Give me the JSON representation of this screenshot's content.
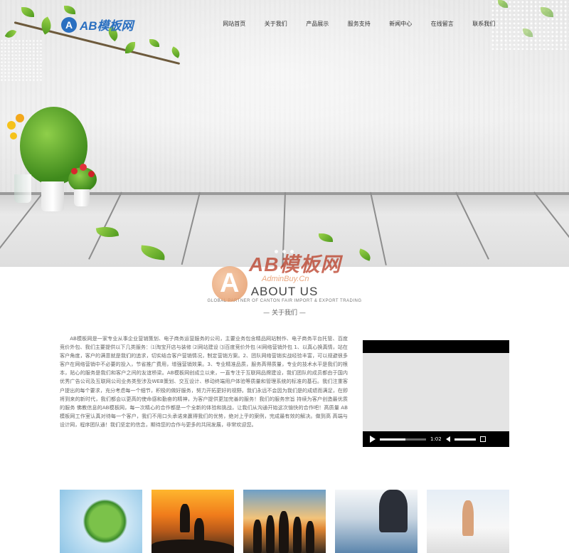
{
  "header": {
    "logo_mark": "A",
    "logo_text": "AB模板网"
  },
  "nav": {
    "items": [
      {
        "label": "网站首页"
      },
      {
        "label": "关于我们"
      },
      {
        "label": "产品展示"
      },
      {
        "label": "服务支持"
      },
      {
        "label": "新闻中心"
      },
      {
        "label": "在线留言"
      },
      {
        "label": "联系我们"
      }
    ]
  },
  "watermark": {
    "text": "AB模板网",
    "url": "AdminBuy.Cn"
  },
  "about": {
    "title": "ABOUT US",
    "subtitle": "GLOBAL PARTNER OF CANTON FAIR IMPORT & EXPORT TRADING",
    "cn_title": "— 关于我们 —",
    "body": "AB模板网是一家专业从事企业营销策划、电子商务运营服务的公司，主要业务包含精品网站制作、电子商务平台托管、百度竞价外包、我们主要提供以下几类服务：⑴淘宝开店与装修 ⑵网站建设 ⑶百度竞价外包 ⑷网络营销外包 1、以真心换真情，站在客户角度，客户的满意就是我们的追求，切实结合客户营销情况，制定营销方案。2、团队网络营销实战经验丰富，可以规避很多客户在网络营销中不必要的投入，节省推广费用，增强营销效果。3、专业精准品质，服务高得质量，专业的技术水平是我们的根本，贴心的服务是我们和客户之间的友谊桥梁。AB模板网创成立以来，一直专注于互联网品牌建设，我们团队的成员都由于国内优秀广告公司及互联网公司业务类型涉及WEB策划、交互设计、移动终端用户体验等质量和管理系统的标准的基石。我们注重客户提出的每个要求，充分考虑每一个细节，积极的做好服务，努力开拓更好的视野。我们永远不会因为我们是的成绩而满足，在即将到来的新时代，我们都会以更高的使命感和勤奋的精神，为客户提供更加完善的服务！我们的服务宗旨 持续为客户创造最优质的服务 佛教信息的AB模板网，每一次精心的合作都是一个全新的体验和挑战，让我们从沟通开始这次愉快的合作吧！高质量 AB模板网工作室认真对待每一个客户，我们不用口头承诺来赢得我们的优势，绝对上乎的案例，完成最有效的解决。做到高 高端与设计网，程序团队通！我们坚定的信念，期待您的合作与更多的共同发展，非常欢迎您。"
  },
  "video": {
    "time": "1:02",
    "progress": 0.55
  },
  "hero": {
    "slide_count": 3,
    "active_slide": 1
  }
}
